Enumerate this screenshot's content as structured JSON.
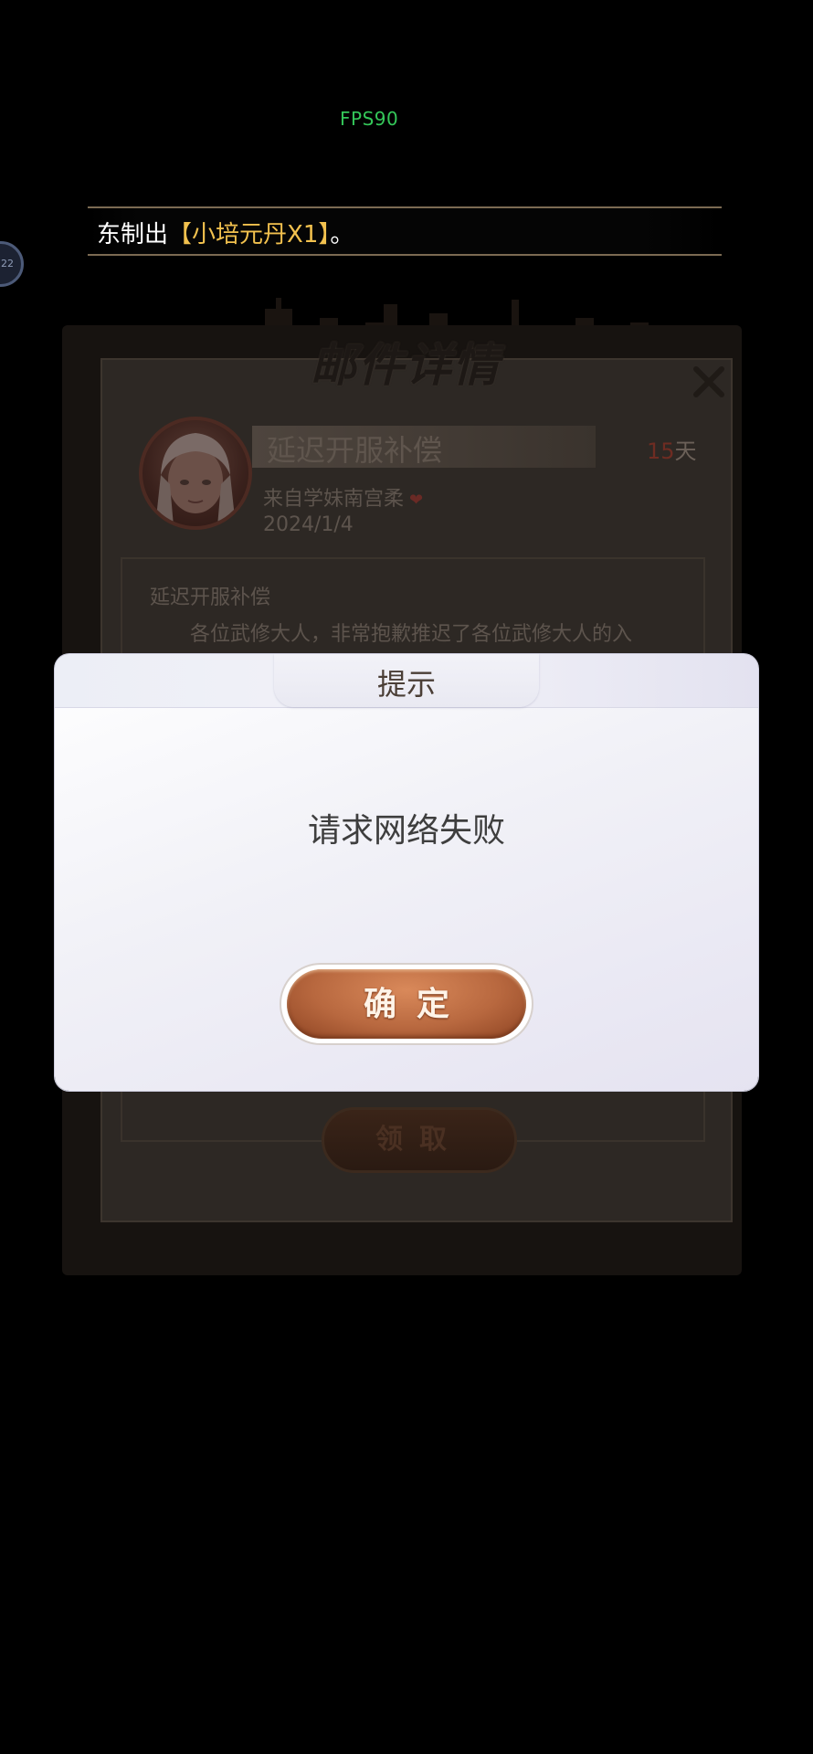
{
  "status": {
    "fps": "FPS90",
    "bubble_text": "22"
  },
  "marquee": {
    "prefix": "东制出",
    "highlight": "【小培元丹X1】",
    "suffix": "。"
  },
  "mail": {
    "title": "邮件详情",
    "subject": "延迟开服补偿",
    "days_num": "15",
    "days_unit": "天",
    "sender": "来自学妹南宫柔",
    "date": "2024/1/4",
    "body_title": "延迟开服补偿",
    "body_line": "各位武修大人，非常抱歉推迟了各位武修大人的入",
    "claim_label": "领取"
  },
  "prompt": {
    "title": "提示",
    "message": "请求网络失败",
    "confirm_label": "确定"
  },
  "colors": {
    "fps": "#34c759",
    "highlight": "#f2c14e",
    "confirm_button": "#b8683f"
  },
  "icons": {
    "close": "close-icon",
    "heart": "heart-icon"
  }
}
